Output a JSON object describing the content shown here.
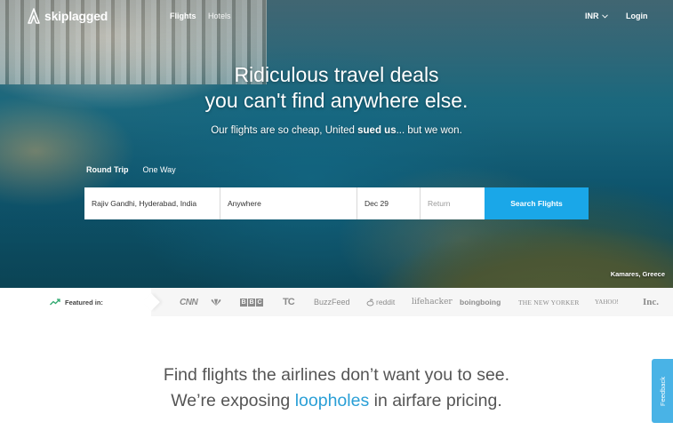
{
  "nav": {
    "brand": "skiplagged",
    "links": {
      "flights": "Flights",
      "hotels": "Hotels"
    },
    "currency": "INR",
    "login": "Login"
  },
  "hero": {
    "headline_line1": "Ridiculous travel deals",
    "headline_line2": "you can't find anywhere else.",
    "sub_prefix": "Our flights are so cheap, United ",
    "sub_bold": "sued us",
    "sub_suffix": "... but we won.",
    "location_caption": "Kamares, Greece"
  },
  "trip_types": {
    "round_trip": "Round Trip",
    "one_way": "One Way",
    "selected": "Round Trip"
  },
  "search": {
    "from_value": "Rajiv Gandhi, Hyderabad, India",
    "to_value": "Anywhere",
    "depart_value": "Dec 29",
    "return_placeholder": "Return",
    "button_label": "Search Flights"
  },
  "featured": {
    "label": "Featured in:",
    "outlets": {
      "cnn": "CNN",
      "bbc": [
        "B",
        "B",
        "C"
      ],
      "techcrunch": "TC",
      "buzzfeed": "BuzzFeed",
      "reddit": "reddit",
      "lifehacker": "lifehacker",
      "boingboing": "boingboing",
      "newyorker": "THE NEW YORKER",
      "yahoo": "YAHOO!",
      "inc": "Inc."
    }
  },
  "tagline": {
    "line1": "Find flights the airlines don’t want you to see.",
    "line2_prefix": "We’re exposing ",
    "line2_accent": "loopholes",
    "line2_suffix": " in airfare pricing."
  },
  "feedback": "Feedback",
  "colors": {
    "accent": "#1aa7e8",
    "tagline_accent": "#2a9fd6",
    "feedback_tab": "#49b3e6"
  },
  "icons": [
    "skiplagged-logo-icon",
    "chevron-down-icon",
    "trending-up-icon",
    "nbc-peacock-icon",
    "reddit-alien-icon"
  ]
}
